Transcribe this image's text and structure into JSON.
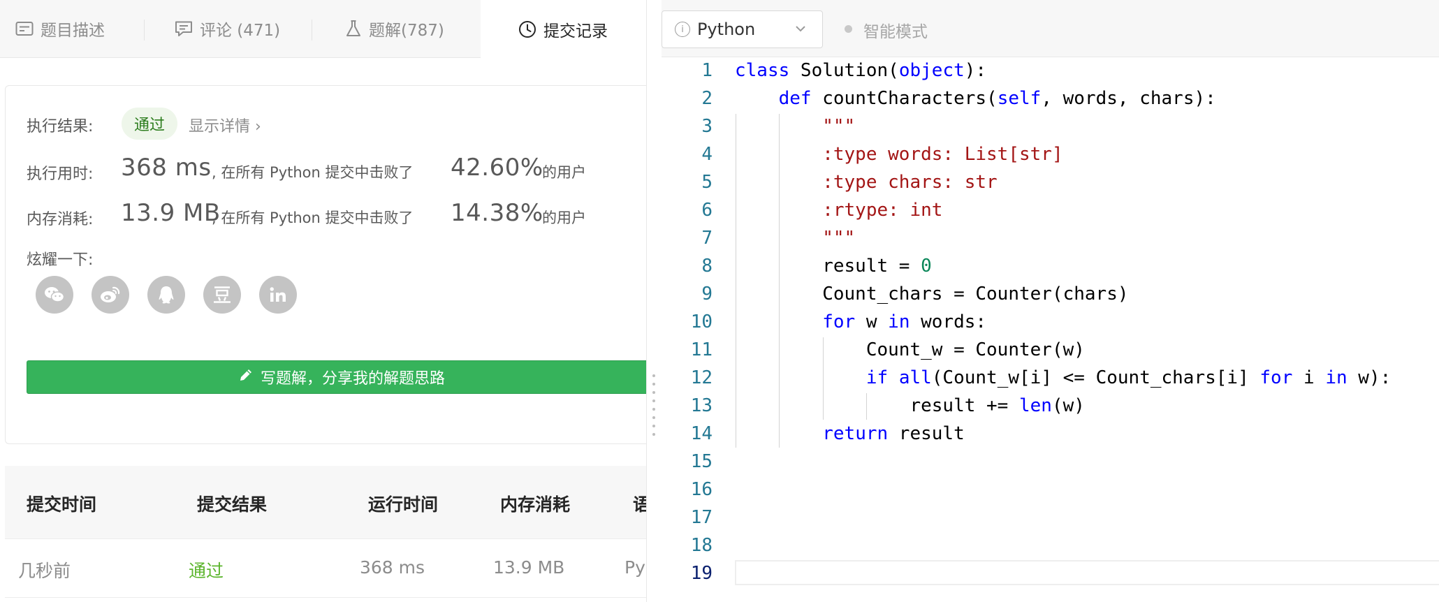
{
  "tabs": [
    {
      "label": "题目描述",
      "icon": "description-icon"
    },
    {
      "label": "评论 (471)",
      "icon": "comment-icon"
    },
    {
      "label": "题解(787)",
      "icon": "flask-icon"
    },
    {
      "label": "提交记录",
      "icon": "clock-icon",
      "active": true
    }
  ],
  "result": {
    "status_label": "执行结果:",
    "status": "通过",
    "detail_link": "显示详情 ›",
    "runtime_label": "执行用时:",
    "runtime_value": "368 ms",
    "runtime_text": ", 在所有 Python 提交中击败了",
    "runtime_percent": "42.60%",
    "runtime_suffix": "的用户",
    "memory_label": "内存消耗:",
    "memory_value": "13.9 MB",
    "memory_text": ", 在所有 Python 提交中击败了",
    "memory_percent": "14.38%",
    "memory_suffix": "的用户",
    "share_label": "炫耀一下:",
    "share_icons": [
      "wechat-icon",
      "weibo-icon",
      "qq-icon",
      "douban-icon",
      "linkedin-icon"
    ],
    "write_solution_button": "写题解，分享我的解题思路"
  },
  "submissions": {
    "headers": [
      "提交时间",
      "提交结果",
      "运行时间",
      "内存消耗",
      "语"
    ],
    "rows": [
      {
        "time": "几秒前",
        "result": "通过",
        "runtime": "368 ms",
        "memory": "13.9 MB",
        "language": "Py"
      }
    ]
  },
  "editor": {
    "language": "Python",
    "smart_mode": "智能模式",
    "current_line": 19,
    "line_numbers": [
      "1",
      "2",
      "3",
      "4",
      "5",
      "6",
      "7",
      "8",
      "9",
      "10",
      "11",
      "12",
      "13",
      "14",
      "15",
      "16",
      "17",
      "18",
      "19"
    ],
    "code_lines": [
      "class Solution(object):",
      "    def countCharacters(self, words, chars):",
      "        \"\"\"",
      "        :type words: List[str]",
      "        :type chars: str",
      "        :rtype: int",
      "        \"\"\"",
      "        result = 0",
      "        Count_chars = Counter(chars)",
      "        for w in words:",
      "            Count_w = Counter(w)",
      "            if all(Count_w[i] <= Count_chars[i] for i in w):",
      "                result += len(w)",
      "        return result",
      "",
      "",
      "",
      "",
      ""
    ]
  }
}
